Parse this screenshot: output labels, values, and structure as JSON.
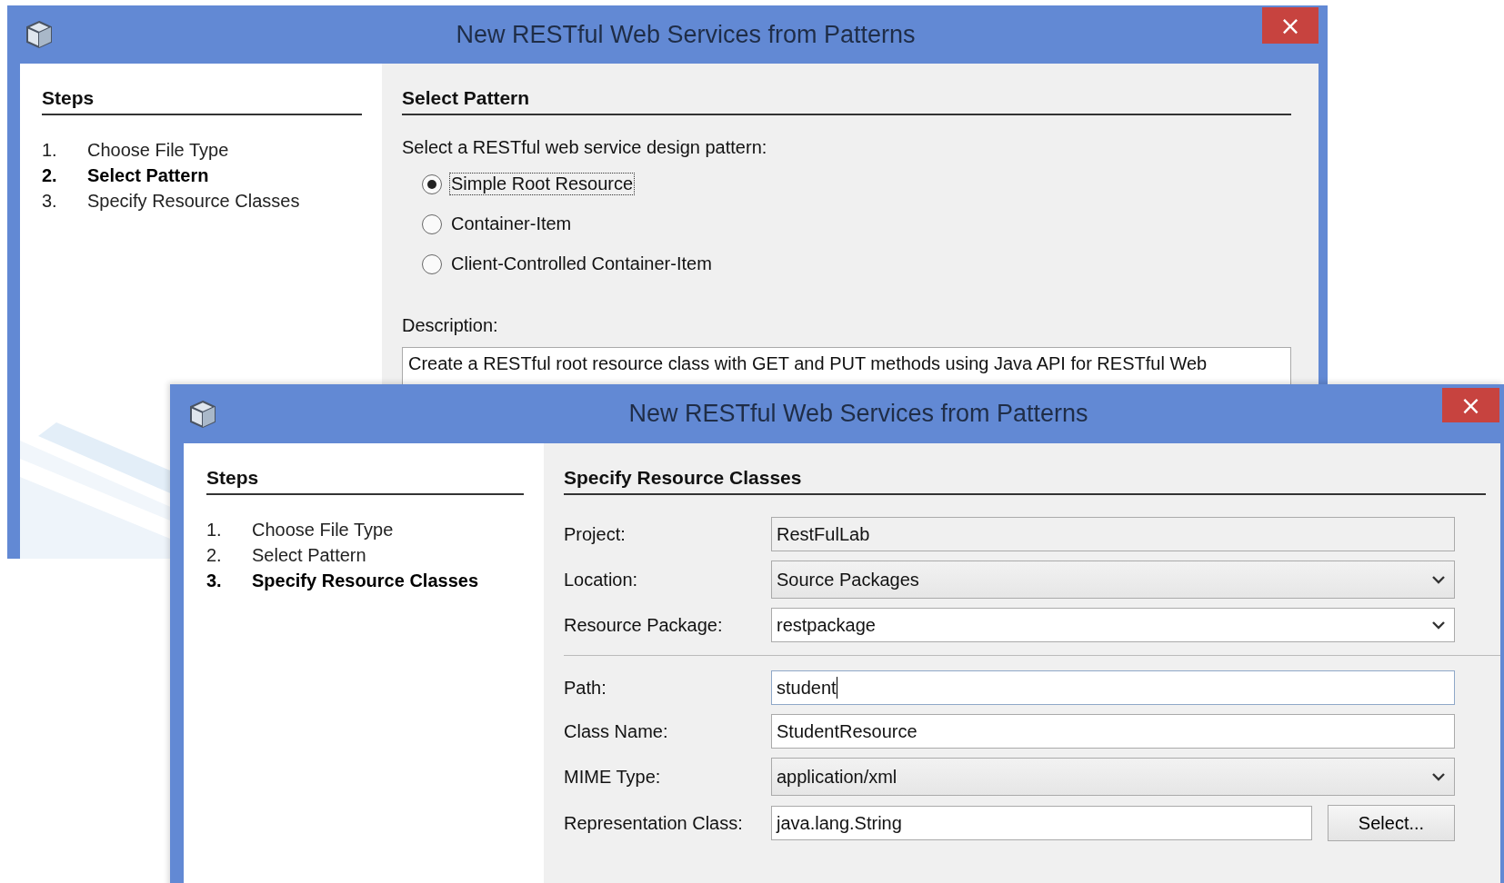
{
  "back_dialog": {
    "title": "New RESTful Web Services from Patterns",
    "close": "×",
    "steps_title": "Steps",
    "steps": [
      {
        "number": "1.",
        "label": "Choose File Type",
        "selected": false
      },
      {
        "number": "2.",
        "label": "Select Pattern",
        "selected": true
      },
      {
        "number": "3.",
        "label": "Specify Resource Classes",
        "selected": false
      }
    ],
    "panel_title": "Select Pattern",
    "prompt": "Select a RESTful web service design pattern:",
    "patterns": [
      {
        "label": "Simple Root Resource",
        "selected": true
      },
      {
        "label": "Container-Item",
        "selected": false
      },
      {
        "label": "Client-Controlled Container-Item",
        "selected": false
      }
    ],
    "description_label": "Description:",
    "description": "Create a RESTful root resource class with GET and PUT methods using Java API for RESTful Web"
  },
  "front_dialog": {
    "title": "New RESTful Web Services from Patterns",
    "close": "×",
    "steps_title": "Steps",
    "steps": [
      {
        "number": "1.",
        "label": "Choose File Type",
        "selected": false
      },
      {
        "number": "2.",
        "label": "Select Pattern",
        "selected": false
      },
      {
        "number": "3.",
        "label": "Specify Resource Classes",
        "selected": true
      }
    ],
    "panel_title": "Specify Resource Classes",
    "location_fields": [
      {
        "kind": "readonly",
        "label": "Project:",
        "value": "RestFulLab",
        "focused": false
      },
      {
        "kind": "dropdown",
        "label": "Location:",
        "value": "Source Packages",
        "focused": false
      },
      {
        "kind": "editable-dropdown",
        "label": "Resource Package:",
        "value": "restpackage",
        "focused": false
      }
    ],
    "class_fields": [
      {
        "kind": "text",
        "label": "Path:",
        "value": "student",
        "focused": true
      },
      {
        "kind": "text",
        "label": "Class Name:",
        "value": "StudentResource",
        "focused": false
      },
      {
        "kind": "dropdown",
        "label": "MIME Type:",
        "value": "application/xml",
        "focused": false
      },
      {
        "kind": "text-with-button",
        "label": "Representation Class:",
        "value": "java.lang.String",
        "button": "Select...",
        "focused": false
      }
    ]
  }
}
